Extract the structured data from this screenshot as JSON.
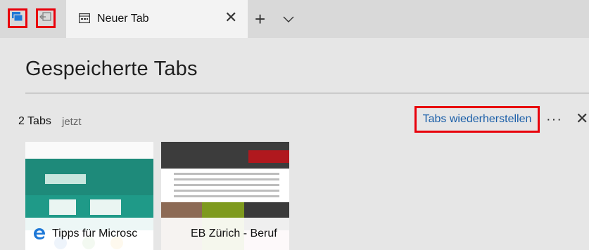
{
  "tabstrip": {
    "set_aside_icon": "tabs-aside-icon",
    "restore_icon": "restore-tabs-icon",
    "active_tab": {
      "title": "Neuer Tab",
      "favicon": "new-tab-page-icon"
    },
    "close_glyph": "✕",
    "new_tab_glyph": "+",
    "tab_list_glyph": "chevron-down-icon"
  },
  "panel": {
    "title": "Gespeicherte Tabs",
    "group": {
      "count_label": "2 Tabs",
      "time_label": "jetzt",
      "restore_label": "Tabs wiederherstellen",
      "more_glyph": "···",
      "close_glyph": "✕"
    },
    "thumbnails": [
      {
        "caption": "Tipps für Microsc",
        "favicon": "edge-logo-icon"
      },
      {
        "caption": "EB Zürich - Beruf"
      }
    ]
  },
  "colors": {
    "highlight": "#e8000b",
    "link": "#1a5ea8",
    "edge_blue": "#1e78d7"
  }
}
